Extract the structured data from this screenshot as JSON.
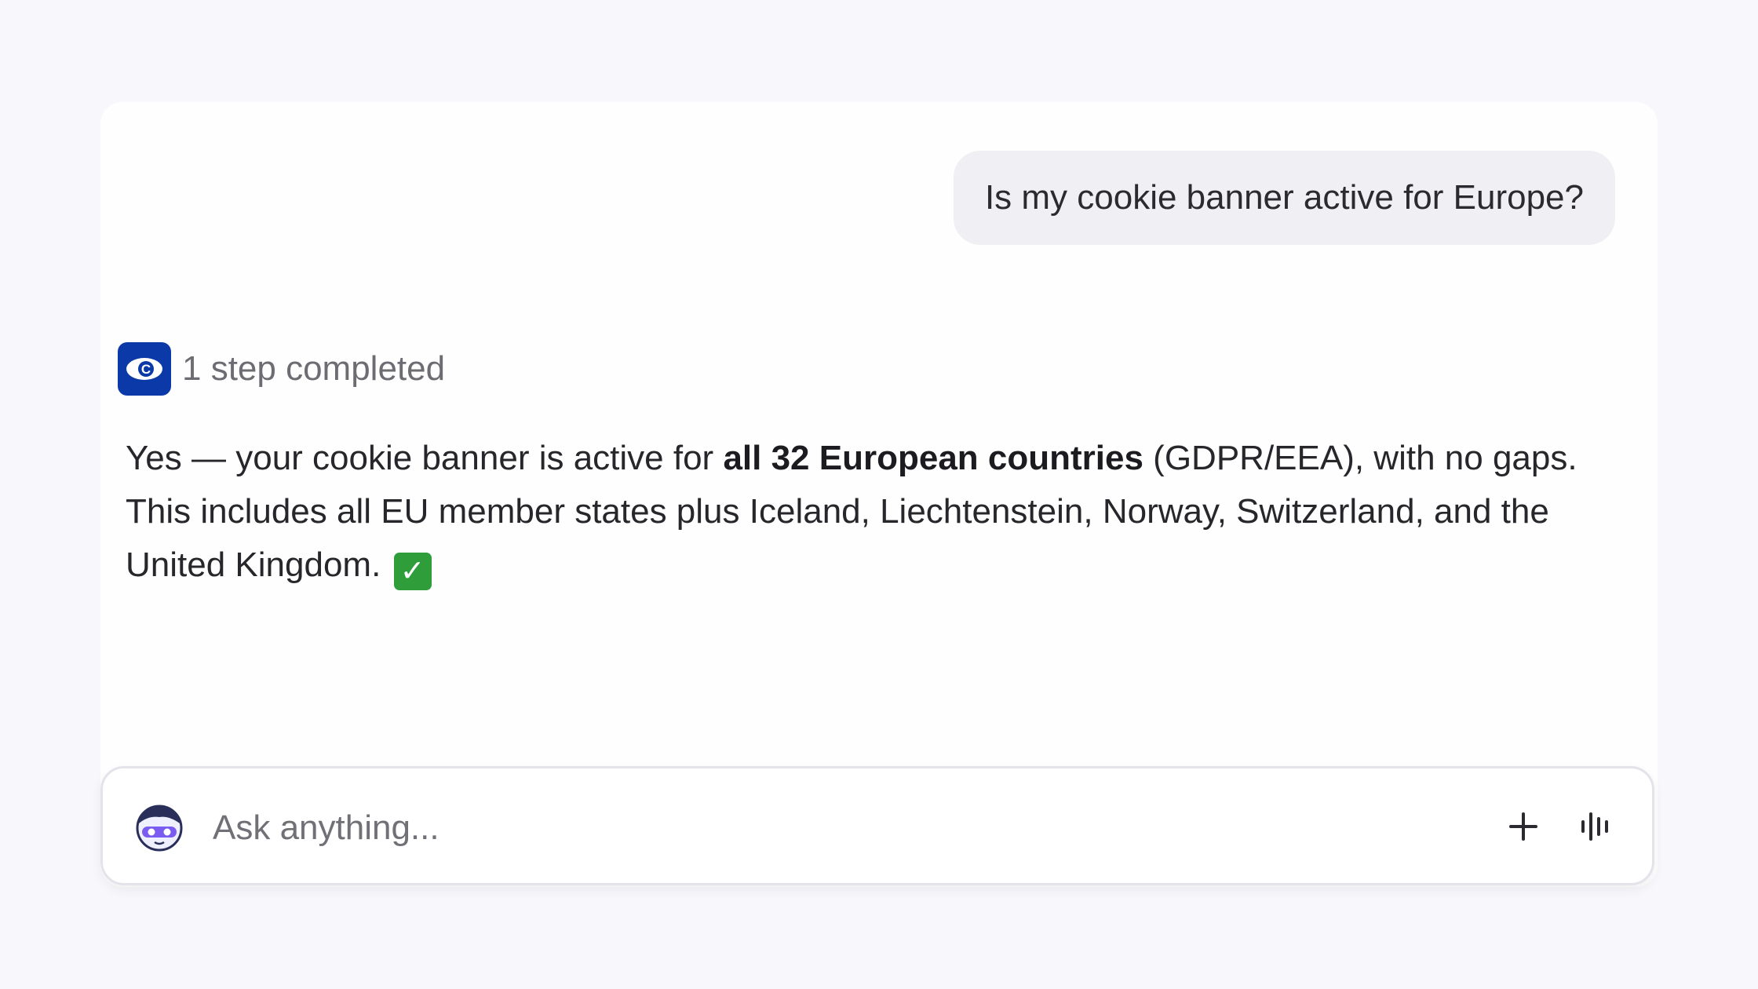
{
  "conversation": {
    "user_message": "Is my cookie banner active for Europe?",
    "step_status": "1 step completed",
    "step_icon": "cookie-consent-logo-icon",
    "answer": {
      "part1": "Yes — your cookie banner is active for ",
      "bold": "all 32 European countries",
      "part2": " (GDPR/EEA), with no gaps. This includes all EU member states plus Iceland, Liechtenstein, Norway, Switzerland, and the United Kingdom.",
      "emoji_icon": "check-mark-button-icon"
    }
  },
  "composer": {
    "placeholder": "Ask anything...",
    "value": "",
    "avatar_icon": "assistant-avatar-icon",
    "plus_icon": "plus-icon",
    "voice_icon": "voice-waveform-icon"
  },
  "colors": {
    "background": "#f8f7fc",
    "accent": "#0b3aa8",
    "check": "#2f9e3a"
  }
}
